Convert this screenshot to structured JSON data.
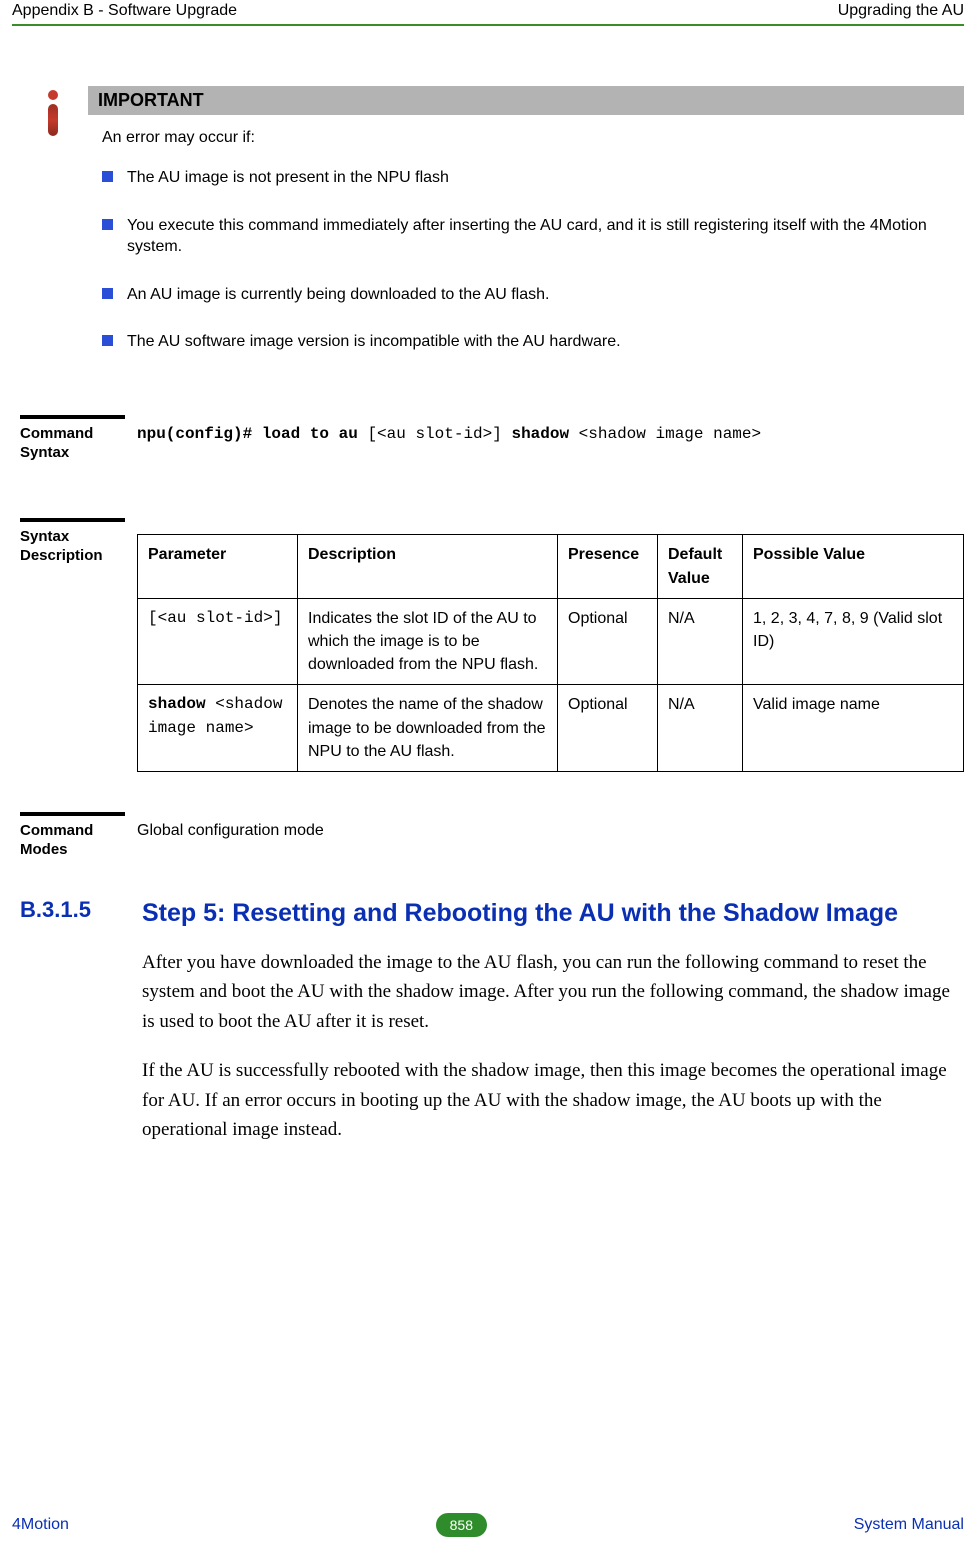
{
  "header": {
    "left": "Appendix B - Software Upgrade",
    "right": "Upgrading the AU"
  },
  "important": {
    "title": "IMPORTANT",
    "intro": "An error may occur if:",
    "bullets": [
      "The AU image is not present in the NPU flash",
      "You execute this command immediately after inserting the AU card, and it is still registering itself with the 4Motion system.",
      "An AU image is currently being downloaded to the AU flash.",
      "The AU software image version is incompatible with the AU hardware."
    ]
  },
  "command_syntax": {
    "label_line1": "Command",
    "label_line2": "Syntax",
    "prefix_bold": "npu(config)# load to au ",
    "arg1": "[<au slot-id>]",
    "mid_bold": " shadow ",
    "arg2": "<shadow image name>"
  },
  "syntax_description": {
    "label_line1": "Syntax",
    "label_line2": "Description",
    "headers": {
      "parameter": "Parameter",
      "description": "Description",
      "presence": "Presence",
      "default": "Default Value",
      "possible": "Possible Value"
    },
    "rows": [
      {
        "param_mono": "[<au slot-id>]",
        "param_bold": "",
        "desc": "Indicates the slot ID of the AU to which the image is to be downloaded from the NPU flash.",
        "presence": "Optional",
        "defv": "N/A",
        "possible": "1, 2, 3, 4, 7, 8, 9 (Valid slot ID)"
      },
      {
        "param_bold": "shadow ",
        "param_mono": "<shadow image name>",
        "desc": "Denotes the name of the shadow image to be downloaded from the NPU to the AU flash.",
        "presence": "Optional",
        "defv": "N/A",
        "possible": "Valid image name"
      }
    ]
  },
  "command_modes": {
    "label_line1": "Command",
    "label_line2": "Modes",
    "text": "Global configuration mode"
  },
  "section": {
    "number": "B.3.1.5",
    "title": "Step 5: Resetting and Rebooting the AU with the Shadow Image",
    "para1": "After you have downloaded the image to the AU flash, you can run the following command to reset the system and boot the AU with the shadow image. After you run the following command, the shadow image is used to boot the AU after it is reset.",
    "para2": "If the AU is successfully rebooted with the shadow image, then this image becomes the operational image for AU. If an error occurs in booting up the AU with the shadow image, the AU boots up with the operational image instead."
  },
  "footer": {
    "left": "4Motion",
    "page": "858",
    "right": "System Manual"
  }
}
